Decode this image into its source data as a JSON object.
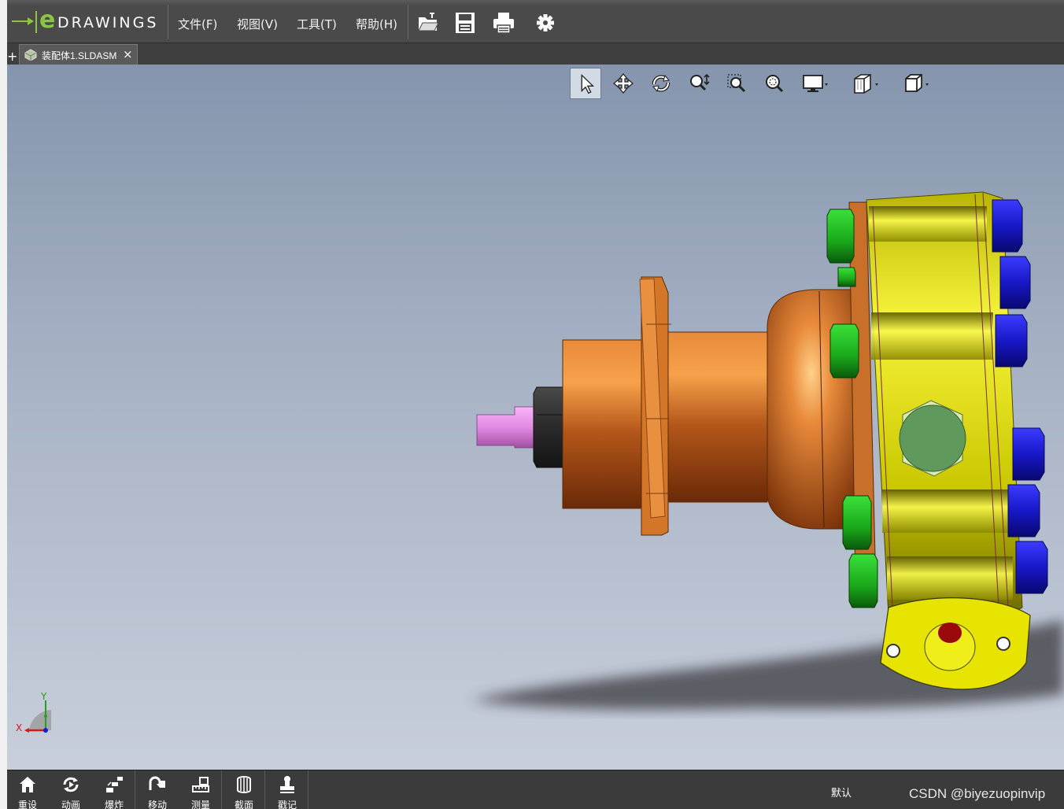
{
  "app": {
    "logo_text": "DRAWINGS",
    "logo_prefix": "e"
  },
  "menu": {
    "file": "文件(F)",
    "view": "视图(V)",
    "tools": "工具(T)",
    "help": "帮助(H)"
  },
  "toolbar": {
    "icons": [
      "open-icon",
      "save-icon",
      "print-icon",
      "settings-icon"
    ]
  },
  "tabs": {
    "plus": "+",
    "document": "装配体1.SLDASM",
    "close": "×"
  },
  "view_tools": [
    "select-icon",
    "pan-icon",
    "rotate-icon",
    "zoom-to-fit-icon",
    "zoom-to-area-icon",
    "zoom-icon",
    "display-style-icon",
    "section-view-icon",
    "view-orientation-icon"
  ],
  "triad": {
    "x_label": "X",
    "y_label": "Y"
  },
  "bottom_tools": [
    {
      "label": "重设",
      "icon": "home-icon"
    },
    {
      "label": "动画",
      "icon": "animate-icon"
    },
    {
      "label": "爆炸",
      "icon": "explode-icon"
    },
    {
      "label": "移动",
      "icon": "move-icon"
    },
    {
      "label": "测量",
      "icon": "measure-icon"
    },
    {
      "label": "截面",
      "icon": "section-icon"
    },
    {
      "label": "戳记",
      "icon": "stamp-icon"
    }
  ],
  "status": {
    "view_state": "默认"
  },
  "watermark": "CSDN @biyezuopinvip",
  "colors": {
    "logo_green": "#8cc63f",
    "toolbar_bg": "#4a4a4a",
    "viewport_top": "#8595ad",
    "viewport_bottom": "#c8cfdb",
    "part_copper": "#c2651f",
    "part_yellow": "#e8e600",
    "bolt_blue": "#1c1ccc",
    "bolt_green": "#2bbf2b",
    "shaft_pink": "#e48ee4",
    "nut_gray": "#3a3a3a"
  }
}
